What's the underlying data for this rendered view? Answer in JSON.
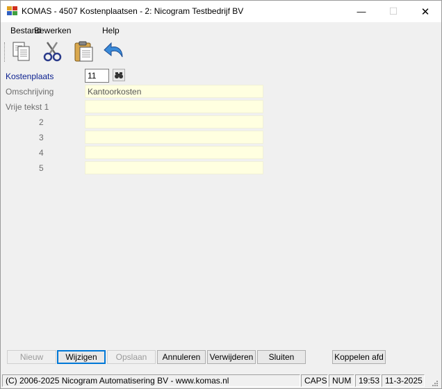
{
  "window": {
    "title": "KOMAS - 4507 Kostenplaatsen - 2: Nicogram Testbedrijf BV",
    "minimize_glyph": "—",
    "maximize_glyph": "☐",
    "close_glyph": "✕"
  },
  "menu": [
    "Bestand",
    "Bewerken",
    "Help"
  ],
  "toolbar": {
    "icons": [
      "copy-icon",
      "cut-icon",
      "paste-icon",
      "undo-icon"
    ]
  },
  "form": {
    "kostenplaats_label": "Kostenplaats",
    "kostenplaats_value": "11",
    "omschrijving_label": "Omschrijving",
    "omschrijving_value": "Kantoorkosten",
    "vrije_tekst_label": "Vrije tekst 1",
    "line_numbers": [
      "2",
      "3",
      "4",
      "5"
    ],
    "line_values": [
      "",
      "",
      "",
      ""
    ]
  },
  "buttons": {
    "nieuw": "Nieuw",
    "wijzigen": "Wijzigen",
    "opslaan": "Opslaan",
    "annuleren": "Annuleren",
    "verwijderen": "Verwijderen",
    "sluiten": "Sluiten",
    "koppelen": "Koppelen afd"
  },
  "statusbar": {
    "copyright": "(C) 2006-2025 Nicogram Automatisering BV - www.komas.nl",
    "caps": "CAPS",
    "num": "NUM",
    "time": "19:53",
    "date": "11-3-2025"
  },
  "colors": {
    "field_bg": "#ffffe0",
    "label_blue": "#0a1f8f",
    "label_gray": "#6d6d6d",
    "focus_blue": "#0078d7"
  }
}
